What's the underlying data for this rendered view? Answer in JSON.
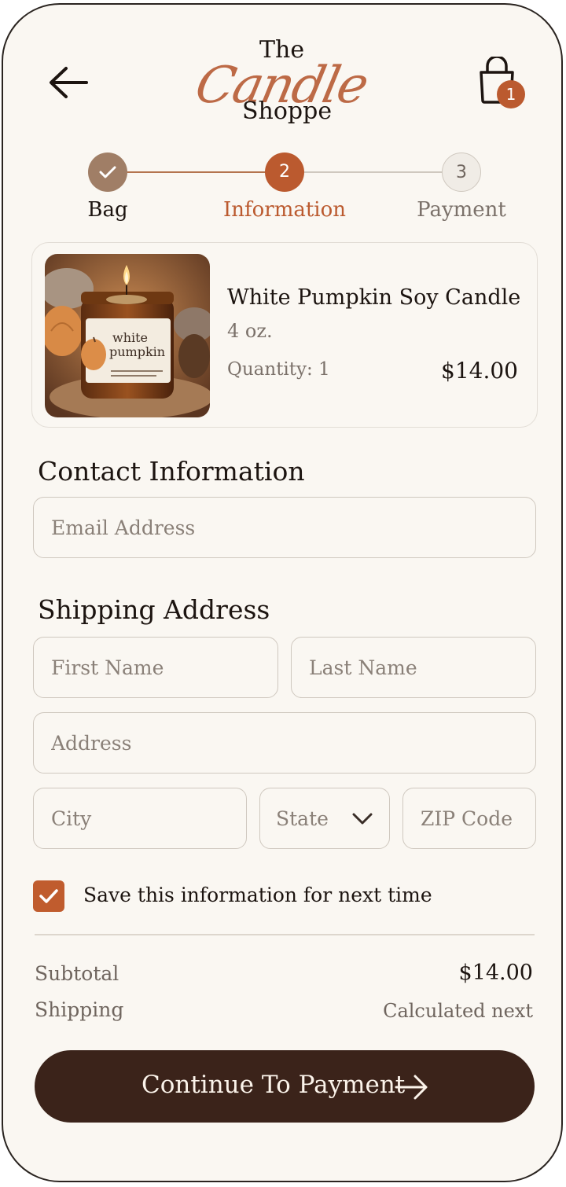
{
  "header": {
    "logo_top": "The",
    "logo_script": "Candle",
    "logo_bottom": "Shoppe",
    "bag_count": "1",
    "icons": {
      "back": "arrow-left-icon",
      "bag": "shopping-bag-icon"
    }
  },
  "steps": [
    {
      "label": "Bag",
      "number": "",
      "state": "complete"
    },
    {
      "label": "Information",
      "number": "2",
      "state": "active"
    },
    {
      "label": "Payment",
      "number": "3",
      "state": "upcoming"
    }
  ],
  "product": {
    "name": "White Pumpkin Soy Candle",
    "size": "4 oz.",
    "quantity_text": "Quantity: 1",
    "price": "$14.00",
    "jar_label_line1": "white",
    "jar_label_line2": "pumpkin"
  },
  "contact": {
    "title": "Contact Information",
    "email_placeholder": "Email Address"
  },
  "shipping": {
    "title": "Shipping Address",
    "first_name_placeholder": "First Name",
    "last_name_placeholder": "Last Name",
    "address_placeholder": "Address",
    "city_placeholder": "City",
    "state_label": "State",
    "zip_placeholder": "ZIP Code"
  },
  "save_info": {
    "label": "Save this information for next time",
    "checked": true
  },
  "summary": {
    "subtotal_label": "Subtotal",
    "subtotal_value": "$14.00",
    "shipping_label": "Shipping",
    "shipping_value": "Calculated next"
  },
  "cta": {
    "label": "Continue To Payment"
  },
  "colors": {
    "accent": "#bb5a2f",
    "background": "#faf7f2",
    "button": "#3b231a",
    "step_complete": "#a07e66",
    "muted_text": "#7b716a"
  }
}
